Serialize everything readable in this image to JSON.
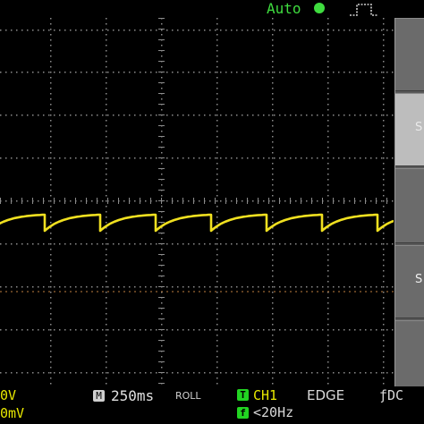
{
  "top_bar": {
    "trigger_mode": "Auto",
    "status_dot_color": "#3fdc3f",
    "trigger_edge_icon": "rising-edge-pulse-icon"
  },
  "side_panel": {
    "buttons": [
      {
        "label": ""
      },
      {
        "label": "S"
      },
      {
        "label": ""
      },
      {
        "label": "S"
      },
      {
        "label": ""
      }
    ]
  },
  "bottom_bar": {
    "channel_scale": "0V",
    "channel_offset": "0mV",
    "horizontal_badge": "M",
    "timebase": "250ms",
    "mode": "ROLL",
    "trigger_badge": "T",
    "trigger_source": "CH1",
    "trigger_type": "EDGE",
    "coupling": "ƒDC",
    "frequency_badge": "f",
    "frequency": "<20Hz"
  },
  "colors": {
    "trace": "#f0e020",
    "grid_dots": "#8c8c8c",
    "ground_marker": "#c08040"
  },
  "waveform": {
    "description_type": "sawtooth-charging",
    "cycles_visible": 7,
    "period_divisions": 1.0
  }
}
